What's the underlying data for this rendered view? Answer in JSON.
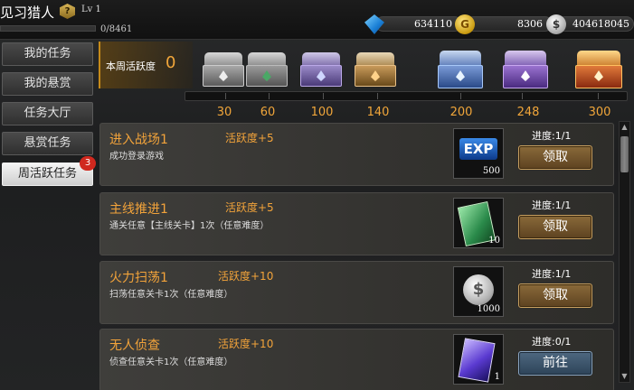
{
  "player": {
    "name": "见习猎人",
    "rank_icon": "?",
    "level": "Lv 1",
    "exp": "0/8461",
    "exp_fraction": 0
  },
  "currencies": [
    {
      "icon": "diamond-icon",
      "value": "634110"
    },
    {
      "icon": "gold-coin-icon",
      "symbol": "G",
      "value": "8306"
    },
    {
      "icon": "silver-coin-icon",
      "symbol": "$",
      "value": "404618045"
    }
  ],
  "nav": {
    "items": [
      {
        "label": "我的任务"
      },
      {
        "label": "我的悬赏"
      },
      {
        "label": "任务大厅"
      },
      {
        "label": "悬赏任务"
      },
      {
        "label": "周活跃任务",
        "badge": "3",
        "active": true
      }
    ]
  },
  "weekly": {
    "label": "本周活跃度",
    "value": "0",
    "thresholds": [
      "30",
      "60",
      "100",
      "140",
      "200",
      "248",
      "300"
    ],
    "chests": [
      {
        "icon": "gray-chest-icon",
        "color": "#9a9a9a"
      },
      {
        "icon": "green-chest-icon",
        "color": "#4aa866"
      },
      {
        "icon": "purple-chest-icon",
        "color": "#8a6ac8"
      },
      {
        "icon": "orange-chest-icon",
        "color": "#c8843a"
      },
      {
        "icon": "blue-chest-icon",
        "color": "#5a8ad6"
      },
      {
        "icon": "violet-chest-icon",
        "color": "#9a62c8"
      },
      {
        "icon": "red-gold-chest-icon",
        "color": "#d06a2a"
      }
    ]
  },
  "tasks": [
    {
      "title": "进入战场1",
      "activity": "活跃度+5",
      "desc": "成功登录游戏",
      "reward_icon": "exp-icon",
      "reward_label": "EXP",
      "reward_count": "500",
      "progress": "进度:1/1",
      "button": "领取",
      "button_type": "claim"
    },
    {
      "title": "主线推进1",
      "activity": "活跃度+5",
      "desc": "通关任意【主线关卡】1次（任意难度）",
      "reward_icon": "green-card-icon",
      "reward_count": "10",
      "progress": "进度:1/1",
      "button": "领取",
      "button_type": "claim"
    },
    {
      "title": "火力扫荡1",
      "activity": "活跃度+10",
      "desc": "扫荡任意关卡1次（任意难度）",
      "reward_icon": "silver-coin-icon",
      "reward_count": "1000",
      "progress": "进度:1/1",
      "button": "领取",
      "button_type": "claim"
    },
    {
      "title": "无人侦查",
      "activity": "活跃度+10",
      "desc": "侦查任意关卡1次（任意难度）",
      "reward_icon": "purple-card-icon",
      "reward_count": "1",
      "progress": "进度:0/1",
      "button": "前往",
      "button_type": "goto"
    }
  ],
  "colors": {
    "accent_orange": "#f2a33a",
    "claim_button": "#8a6a3a",
    "goto_button": "#4e6880",
    "badge_red": "#d0281e"
  }
}
